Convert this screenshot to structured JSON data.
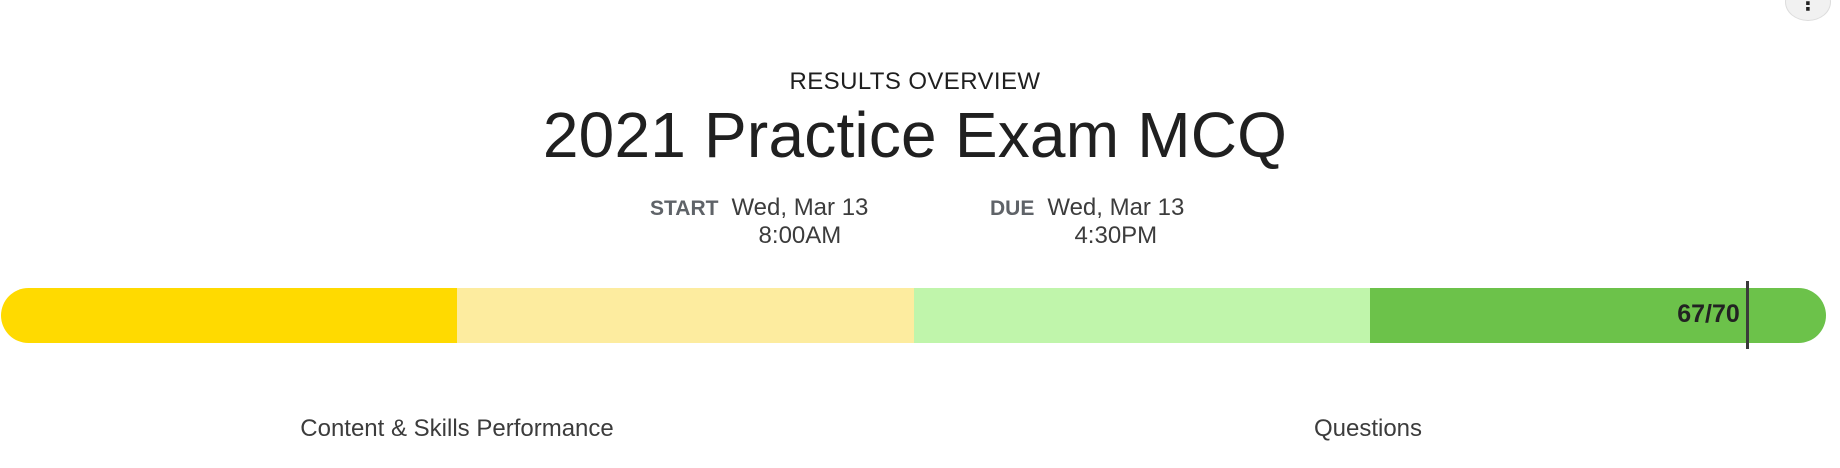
{
  "header": {
    "overview_label": "RESULTS OVERVIEW",
    "exam_title": "2021 Practice Exam MCQ"
  },
  "more_menu": {
    "icon": "more-vertical-icon",
    "glyph": "⋮"
  },
  "dates": {
    "start": {
      "label": "START",
      "date": "Wed, Mar 13",
      "time": "8:00AM"
    },
    "due": {
      "label": "DUE",
      "date": "Wed, Mar 13",
      "time": "4:30PM"
    }
  },
  "score": {
    "text": "67/70",
    "earned": 67,
    "total": 70,
    "segment_colors": [
      "#FFDA00",
      "#FDEC9F",
      "#C0F5AB",
      "#6CC24A"
    ]
  },
  "sections": {
    "content_skills": "Content & Skills Performance",
    "questions": "Questions"
  }
}
